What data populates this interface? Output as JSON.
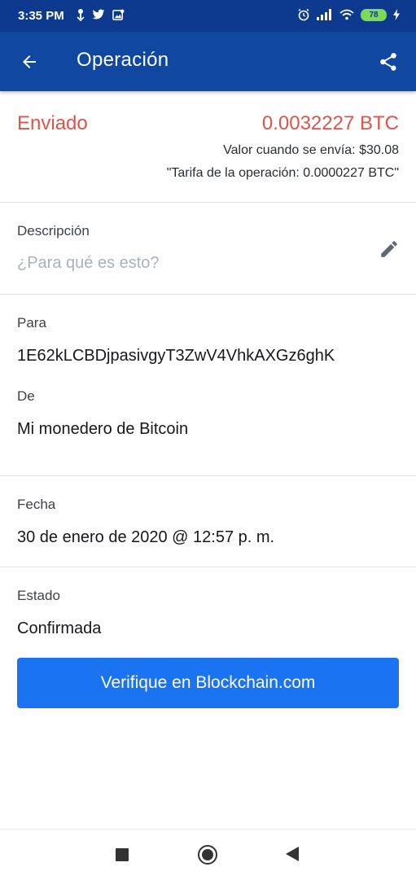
{
  "status_bar": {
    "time": "3:35 PM",
    "battery": "78",
    "icons_left": [
      "download-icon",
      "twitter-icon",
      "gallery-icon"
    ],
    "icons_right": [
      "alarm-icon",
      "signal-icon",
      "wifi-icon",
      "battery-icon",
      "charging-icon"
    ]
  },
  "app_bar": {
    "title": "Operación",
    "back_icon": "arrow-back-icon",
    "share_icon": "share-icon"
  },
  "summary": {
    "direction": "Enviado",
    "amount": "0.0032227 BTC",
    "value_when_sent": "Valor cuando se envía: $30.08",
    "fee": "\"Tarifa de la operación: 0.0000227 BTC\""
  },
  "description": {
    "label": "Descripción",
    "placeholder": "¿Para qué es esto?",
    "edit_icon": "pencil-icon"
  },
  "to": {
    "label": "Para",
    "value": "1E62kLCBDjpasivgyT3ZwV4VhkAXGz6ghK"
  },
  "from": {
    "label": "De",
    "value": "Mi monedero de Bitcoin"
  },
  "date": {
    "label": "Fecha",
    "value": "30 de enero de 2020 @ 12:57 p. m."
  },
  "status": {
    "label": "Estado",
    "value": "Confirmada"
  },
  "verify_button": {
    "label": "Verifique en Blockchain.com"
  },
  "colors": {
    "header": "#0f47a1",
    "sent_accent": "#e0534a",
    "button": "#1a73f0"
  }
}
